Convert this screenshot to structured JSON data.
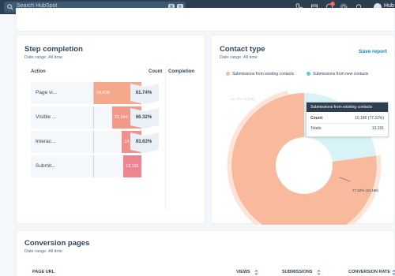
{
  "topbar": {
    "search_placeholder": "Search HubSpot",
    "shortcut_keys": [
      "⌘",
      "K"
    ],
    "notification_count": "1",
    "account_label": "Hub"
  },
  "step_completion": {
    "title": "Step completion",
    "date_range": "Date range: All time",
    "col_action": "Action",
    "col_count": "Count",
    "col_completion": "Completion",
    "rows": [
      {
        "label": "Page vi...",
        "count": "34,408",
        "count_value": 34408
      },
      {
        "label": "Visible ...",
        "count": "21,244",
        "count_value": 21244
      },
      {
        "label": "Interac...",
        "count": "14,088",
        "count_value": 14088
      },
      {
        "label": "Submit...",
        "count": "13,191",
        "count_value": 13191
      }
    ],
    "completions": [
      "61.74%",
      "66.32%",
      "93.63%"
    ]
  },
  "contact_type": {
    "title": "Contact type",
    "date_range": "Date range: All time",
    "save_label": "Save report",
    "legend": [
      {
        "label": "Submissions from existing contacts",
        "color": "#f8b99c"
      },
      {
        "label": "Submissions from new contacts",
        "color": "#51d3d9"
      }
    ],
    "chart_data": {
      "type": "pie",
      "style": "donut",
      "slices": [
        {
          "label": "Submissions from existing contacts",
          "value": 10186,
          "percent": 77.22,
          "color": "#f8b99c"
        },
        {
          "label": "Submissions from new contacts",
          "value": 3005,
          "percent": 22.78,
          "color": "#d8f3f5"
        }
      ],
      "slice_labels": [
        "77.22% (10,186)",
        "22.78% (3,005)"
      ]
    },
    "tooltip": {
      "title": "Submissions from existing contacts",
      "count_label": "Count:",
      "count_value": "10,186 (77.22%)",
      "totals_label": "Totals:",
      "totals_value": "13,191"
    }
  },
  "conversion_pages": {
    "title": "Conversion pages",
    "date_range": "Date range: All time",
    "columns": [
      "PAGE URL",
      "VIEWS",
      "SUBMISSIONS",
      "CONVERSION RATE"
    ]
  }
}
